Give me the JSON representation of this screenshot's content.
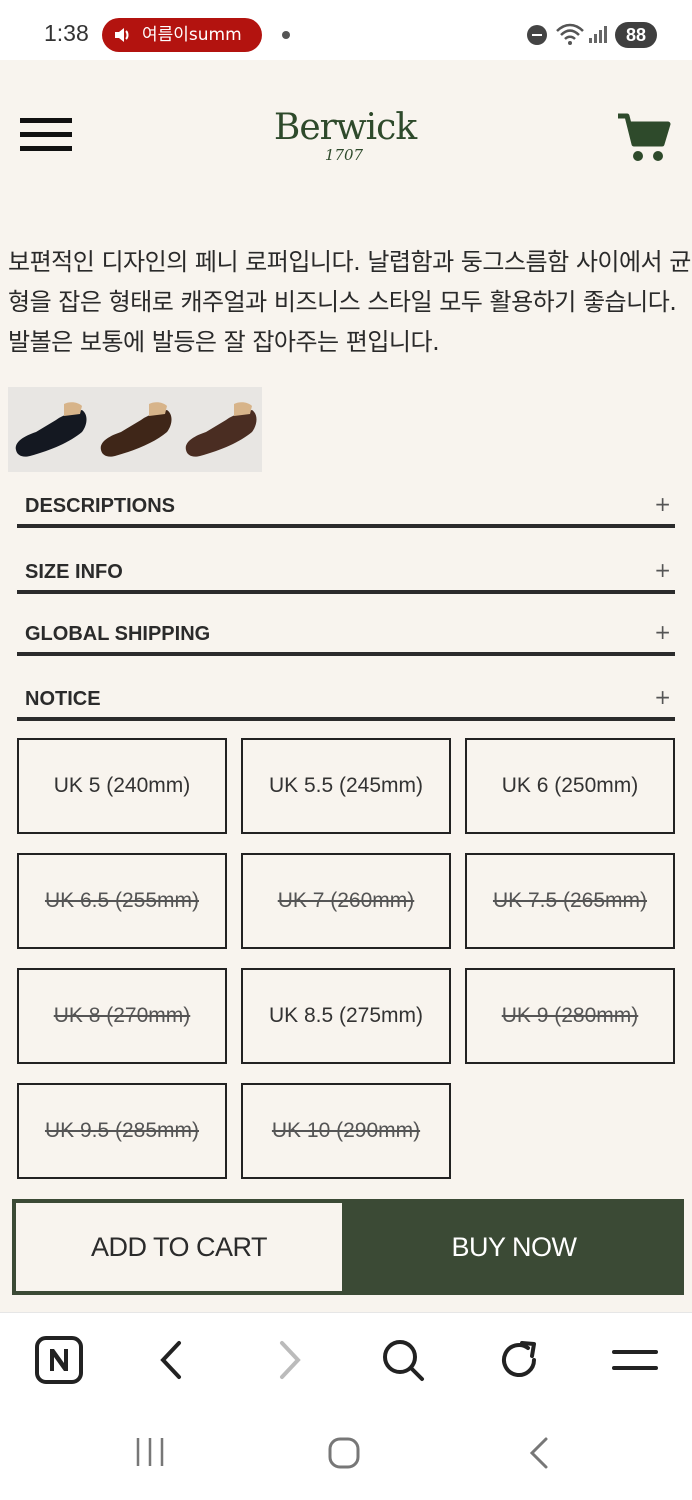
{
  "status_bar": {
    "time": "1:38",
    "media_text": "여름이summ",
    "battery": "88"
  },
  "header": {
    "brand": "Berwick",
    "year": "1707"
  },
  "product": {
    "description": " 보편적인 디자인의 페니 로퍼입니다. 날렵함과 둥그스름함 사이에서 균형을 잡은 형태로 캐주얼과 비즈니스 스타일 모두 활용하기 좋습니다. 발볼은 보통에 발등은 잘 잡아주는 편입니다.",
    "thumbnails": [
      "navy-suede-loafer",
      "brown-suede-loafer",
      "dark-brown-leather-loafer"
    ]
  },
  "accordion": [
    {
      "label": "DESCRIPTIONS",
      "icon": "+"
    },
    {
      "label": "SIZE INFO",
      "icon": "+"
    },
    {
      "label": "GLOBAL SHIPPING",
      "icon": "+"
    },
    {
      "label": "NOTICE",
      "icon": "+"
    }
  ],
  "sizes": [
    {
      "label": "UK 5 (240mm)",
      "available": true
    },
    {
      "label": "UK 5.5 (245mm)",
      "available": true
    },
    {
      "label": "UK 6 (250mm)",
      "available": true
    },
    {
      "label": "UK 6.5 (255mm)",
      "available": false
    },
    {
      "label": "UK 7 (260mm)",
      "available": false
    },
    {
      "label": "UK 7.5 (265mm)",
      "available": false
    },
    {
      "label": "UK 8 (270mm)",
      "available": false
    },
    {
      "label": "UK 8.5 (275mm)",
      "available": true
    },
    {
      "label": "UK 9 (280mm)",
      "available": false
    },
    {
      "label": "UK 9.5 (285mm)",
      "available": false
    },
    {
      "label": "UK 10 (290mm)",
      "available": false
    }
  ],
  "actions": {
    "add_to_cart": "ADD TO CART",
    "buy_now": "BUY NOW"
  },
  "colors": {
    "page_bg": "#f8f4ee",
    "brand_green": "#3b4a35",
    "media_red": "#b3130f"
  }
}
